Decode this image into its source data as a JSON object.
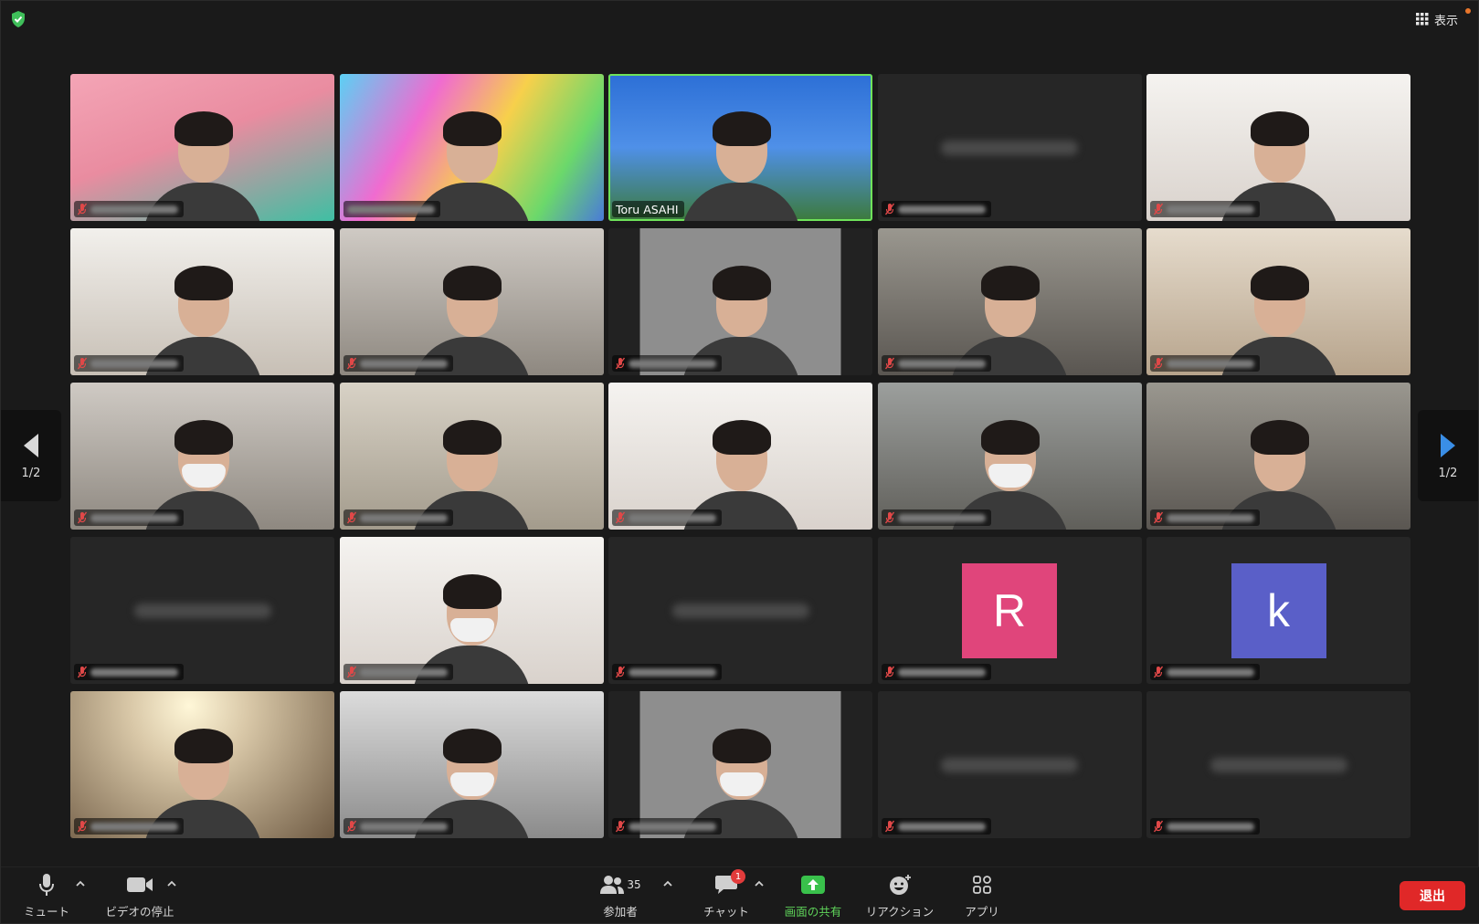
{
  "top": {
    "view_label": "表示"
  },
  "pager": {
    "left_label": "1/2",
    "right_label": "1/2"
  },
  "tiles": [
    {
      "type": "video",
      "bg": "v-pink"
    },
    {
      "type": "video",
      "bg": "v-colorful",
      "muted": false
    },
    {
      "type": "video",
      "bg": "v-sky",
      "name": "Toru ASAHI",
      "active": true,
      "muted": false
    },
    {
      "type": "name"
    },
    {
      "type": "video",
      "bg": "v-white"
    },
    {
      "type": "video",
      "bg": "v-shelf"
    },
    {
      "type": "video",
      "bg": "v-grey"
    },
    {
      "type": "video",
      "bg": "v-narrow"
    },
    {
      "type": "video",
      "bg": "v-dim"
    },
    {
      "type": "video",
      "bg": "v-warm"
    },
    {
      "type": "video",
      "bg": "v-grey",
      "mask": true
    },
    {
      "type": "video",
      "bg": "v-room"
    },
    {
      "type": "video",
      "bg": "v-white"
    },
    {
      "type": "video",
      "bg": "v-office",
      "mask": true
    },
    {
      "type": "video",
      "bg": "v-dim"
    },
    {
      "type": "name"
    },
    {
      "type": "video",
      "bg": "v-white",
      "mask": true
    },
    {
      "type": "name"
    },
    {
      "type": "avatar",
      "letter": "R",
      "color": "#e0457b"
    },
    {
      "type": "avatar",
      "letter": "k",
      "color": "#5a5fc8"
    },
    {
      "type": "video",
      "bg": "v-lamp"
    },
    {
      "type": "video",
      "bg": "v-lab",
      "mask": true
    },
    {
      "type": "video",
      "bg": "v-narrow",
      "mask": true
    },
    {
      "type": "name"
    },
    {
      "type": "name"
    }
  ],
  "toolbar": {
    "mute_label": "ミュート",
    "video_label": "ビデオの停止",
    "participants_label": "参加者",
    "participants_count": "35",
    "chat_label": "チャット",
    "chat_badge": "1",
    "share_label": "画面の共有",
    "reaction_label": "リアクション",
    "apps_label": "アプリ",
    "leave_label": "退出"
  },
  "colors": {
    "active_border": "#6fe35a",
    "share_green": "#5fd35a",
    "leave_red": "#e02828",
    "pager_arrow_right": "#3a8ee6"
  }
}
